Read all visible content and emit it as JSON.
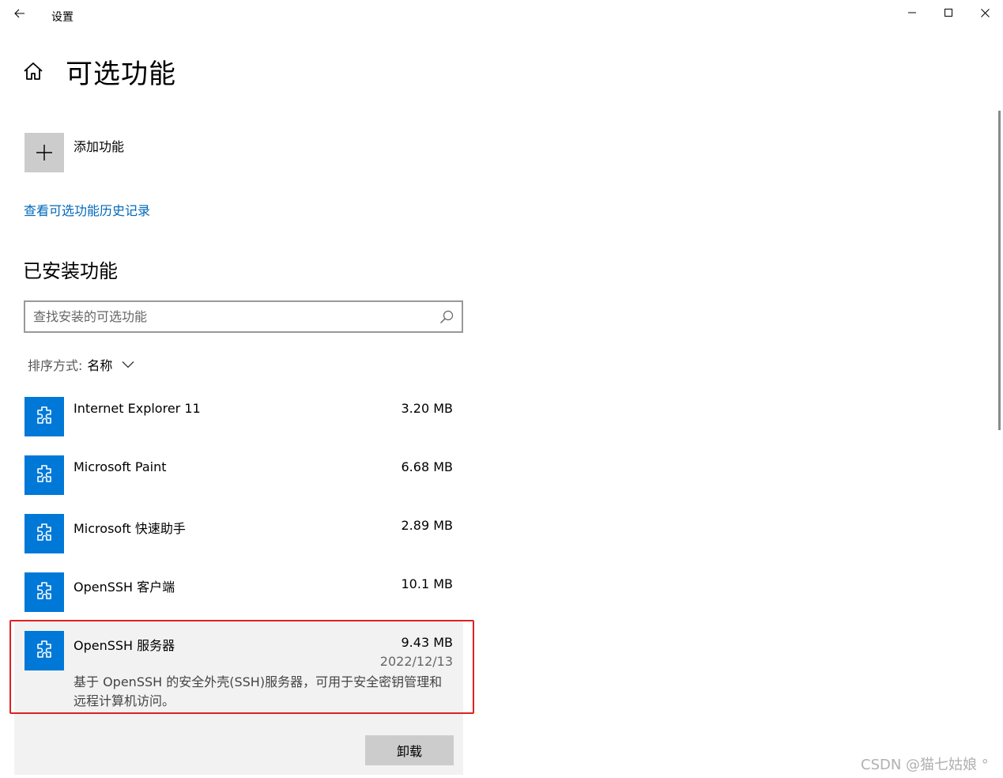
{
  "window": {
    "title": "设置"
  },
  "page": {
    "title": "可选功能"
  },
  "add_feature": {
    "label": "添加功能"
  },
  "history_link": {
    "label": "查看可选功能历史记录"
  },
  "installed": {
    "section_title": "已安装功能",
    "search_placeholder": "查找安装的可选功能",
    "sort_prefix": "排序方式:",
    "sort_value": "名称",
    "items": [
      {
        "name": "Internet Explorer 11",
        "size": "3.20 MB"
      },
      {
        "name": "Microsoft Paint",
        "size": "6.68 MB"
      },
      {
        "name": "Microsoft 快速助手",
        "size": "2.89 MB"
      },
      {
        "name": "OpenSSH 客户端",
        "size": "10.1 MB"
      },
      {
        "name": "OpenSSH 服务器",
        "size": "9.43 MB",
        "date": "2022/12/13",
        "description": "基于 OpenSSH 的安全外壳(SSH)服务器，可用于安全密钥管理和远程计算机访问。",
        "uninstall_label": "卸载",
        "expanded": true
      }
    ]
  },
  "watermark": "CSDN @猫七姑娘 °",
  "colors": {
    "accent": "#0078d7",
    "link": "#0067b8",
    "highlight": "#e02020",
    "tile_gray": "#cccccc",
    "expanded_bg": "#f2f2f2"
  },
  "icons": {
    "back": "arrow-left-icon",
    "minimize": "minimize-icon",
    "maximize": "maximize-icon",
    "close": "close-icon",
    "home": "home-icon",
    "add": "plus-icon",
    "search": "search-icon",
    "sort": "chevron-down-icon",
    "feature": "puzzle-piece-icon"
  }
}
